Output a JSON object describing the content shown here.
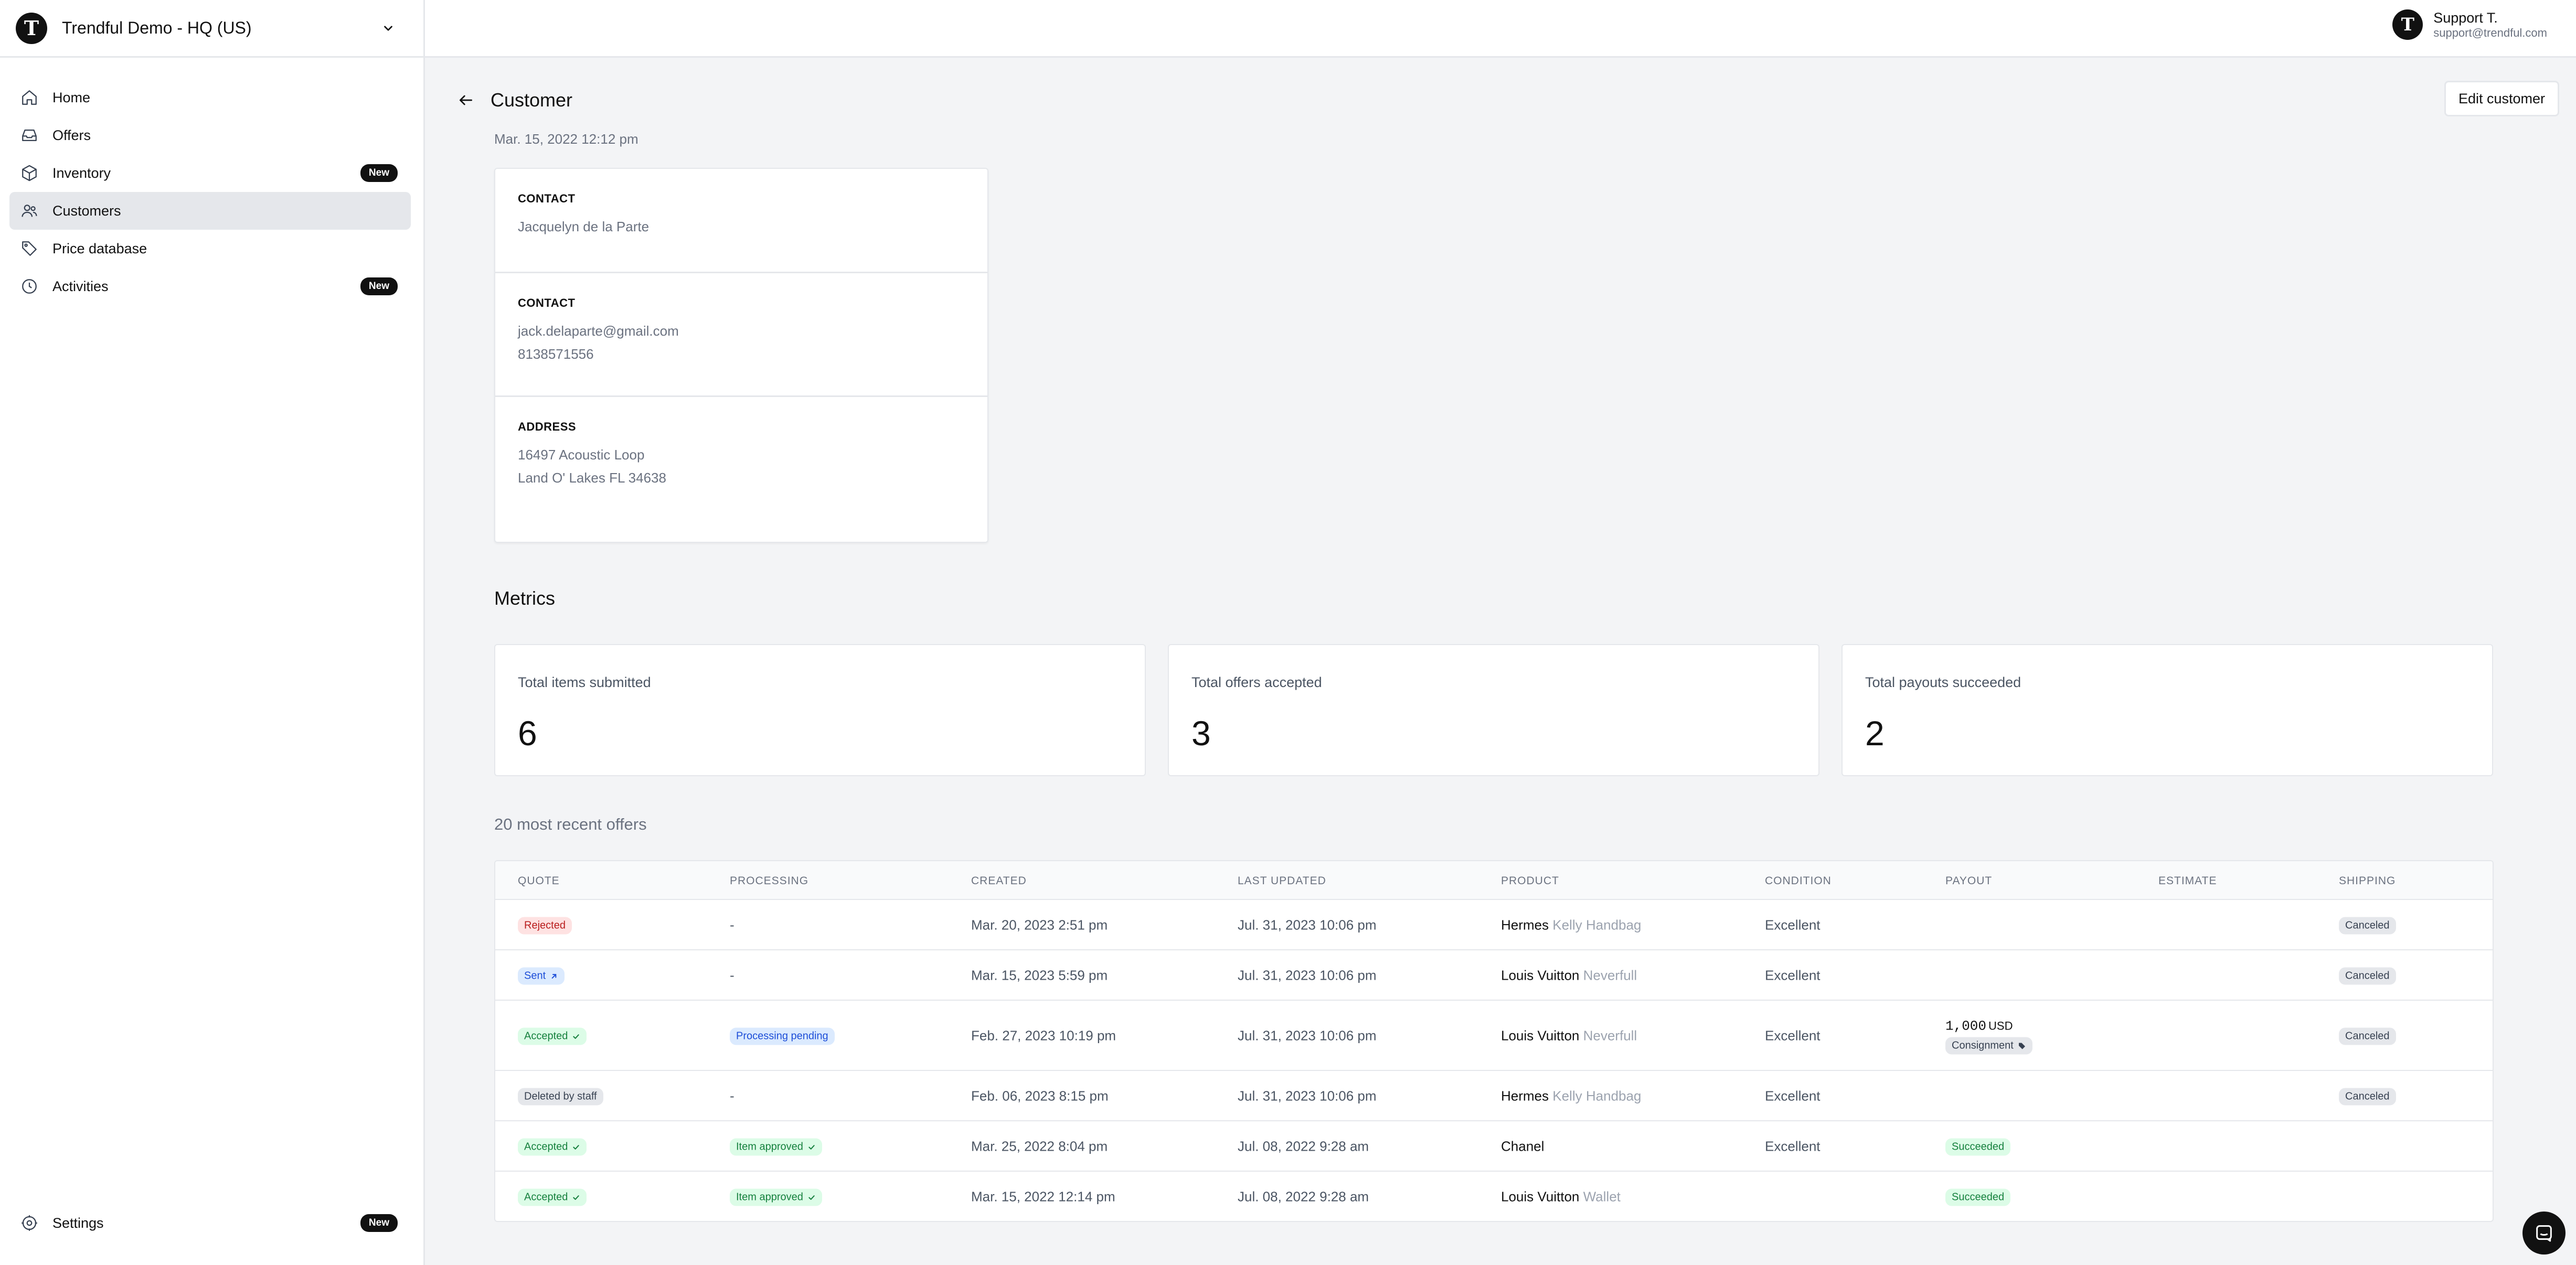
{
  "org": {
    "name": "Trendful Demo - HQ (US)",
    "logo_letter": "T"
  },
  "user": {
    "name": "Support T.",
    "email": "support@trendful.com",
    "avatar_letter": "T"
  },
  "sidebar": {
    "items": [
      {
        "label": "Home",
        "icon": "home-icon"
      },
      {
        "label": "Offers",
        "icon": "inbox-icon"
      },
      {
        "label": "Inventory",
        "icon": "cube-icon",
        "badge": "New"
      },
      {
        "label": "Customers",
        "icon": "users-icon",
        "active": true
      },
      {
        "label": "Price database",
        "icon": "tag-icon"
      },
      {
        "label": "Activities",
        "icon": "clock-icon",
        "badge": "New"
      }
    ],
    "settings": {
      "label": "Settings",
      "icon": "gear-icon",
      "badge": "New"
    }
  },
  "header": {
    "title": "Customer",
    "edit_label": "Edit customer"
  },
  "customer": {
    "created": "Mar. 15, 2022 12:12 pm",
    "contact_label": "CONTACT",
    "name": "Jacquelyn de la Parte",
    "contact2_label": "CONTACT",
    "email": "jack.delaparte@gmail.com",
    "phone": "8138571556",
    "address_label": "ADDRESS",
    "address_line1": "16497 Acoustic Loop",
    "address_line2": "Land O' Lakes FL 34638"
  },
  "metrics": {
    "title": "Metrics",
    "items": [
      {
        "label": "Total items submitted",
        "value": "6"
      },
      {
        "label": "Total offers accepted",
        "value": "3"
      },
      {
        "label": "Total payouts succeeded",
        "value": "2"
      }
    ]
  },
  "offers": {
    "title": "20 most recent offers",
    "columns": [
      "QUOTE",
      "PROCESSING",
      "CREATED",
      "LAST UPDATED",
      "PRODUCT",
      "CONDITION",
      "PAYOUT",
      "ESTIMATE",
      "SHIPPING"
    ],
    "rows": [
      {
        "quote": "Rejected",
        "quote_style": "red",
        "processing": "-",
        "created": "Mar. 20, 2023 2:51 pm",
        "updated": "Jul. 31, 2023 10:06 pm",
        "brand": "Hermes",
        "model": "Kelly Handbag",
        "condition": "Excellent",
        "payout_amount": "",
        "payout_unit": "",
        "payout_tag": "",
        "shipping": "Canceled"
      },
      {
        "quote": "Sent",
        "quote_style": "blue",
        "processing": "-",
        "created": "Mar. 15, 2023 5:59 pm",
        "updated": "Jul. 31, 2023 10:06 pm",
        "brand": "Louis Vuitton",
        "model": "Neverfull",
        "condition": "Excellent",
        "payout_amount": "",
        "payout_unit": "",
        "payout_tag": "",
        "shipping": "Canceled"
      },
      {
        "quote": "Accepted",
        "quote_style": "green",
        "processing": "Processing pending",
        "created": "Feb. 27, 2023 10:19 pm",
        "updated": "Jul. 31, 2023 10:06 pm",
        "brand": "Louis Vuitton",
        "model": "Neverfull",
        "condition": "Excellent",
        "payout_amount": "1,000",
        "payout_unit": "USD",
        "payout_tag": "Consignment",
        "shipping": "Canceled"
      },
      {
        "quote": "Deleted by staff",
        "quote_style": "gray",
        "processing": "-",
        "created": "Feb. 06, 2023 8:15 pm",
        "updated": "Jul. 31, 2023 10:06 pm",
        "brand": "Hermes",
        "model": "Kelly Handbag",
        "condition": "Excellent",
        "payout_amount": "",
        "payout_unit": "",
        "payout_tag": "",
        "shipping": "Canceled"
      },
      {
        "quote": "Accepted",
        "quote_style": "green",
        "processing": "Item approved",
        "created": "Mar. 25, 2022 8:04 pm",
        "updated": "Jul. 08, 2022 9:28 am",
        "brand": "Chanel",
        "model": "",
        "condition": "Excellent",
        "payout_status": "Succeeded",
        "shipping": ""
      },
      {
        "quote": "Accepted",
        "quote_style": "green",
        "processing": "Item approved",
        "created": "Mar. 15, 2022 12:14 pm",
        "updated": "Jul. 08, 2022 9:28 am",
        "brand": "Louis Vuitton",
        "model": "Wallet",
        "condition": "",
        "payout_status": "Succeeded",
        "shipping": ""
      }
    ]
  },
  "colors": {
    "accent": "#111111",
    "red": "#b91c1c",
    "blue": "#1d4ed8",
    "green": "#15803d"
  }
}
